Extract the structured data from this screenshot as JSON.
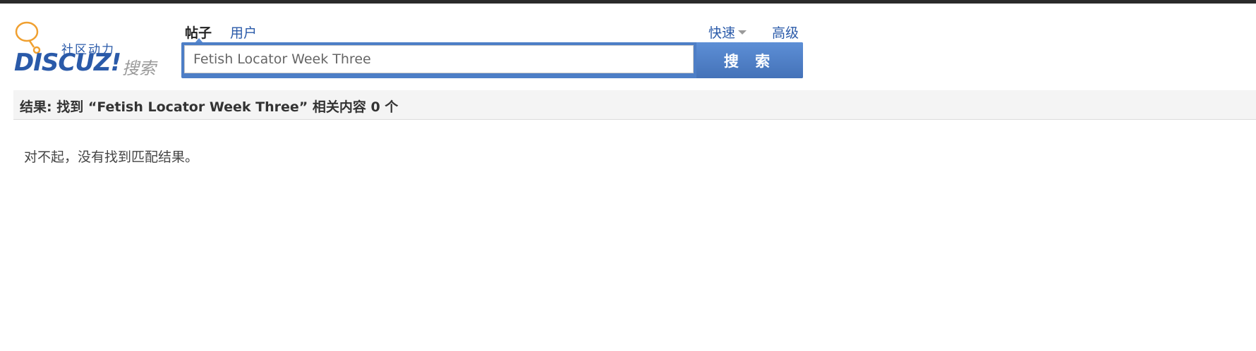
{
  "logo": {
    "tagline": "社区动力",
    "wordmark": "DISCUZ!",
    "sub": "搜索",
    "bubble_color": "#f0a030",
    "brand_color": "#2a5aa9"
  },
  "tabs": [
    {
      "label": "帖子",
      "active": true
    },
    {
      "label": "用户",
      "active": false
    }
  ],
  "links": {
    "quick": "快速",
    "advanced": "高级"
  },
  "search": {
    "value": "Fetish Locator Week Three",
    "button_label": "搜 索",
    "accent_color": "#4d7ec6"
  },
  "results": {
    "summary": "结果: 找到 “Fetish Locator Week Three” 相关内容 0 个",
    "empty_message": "对不起，没有找到匹配结果。"
  }
}
